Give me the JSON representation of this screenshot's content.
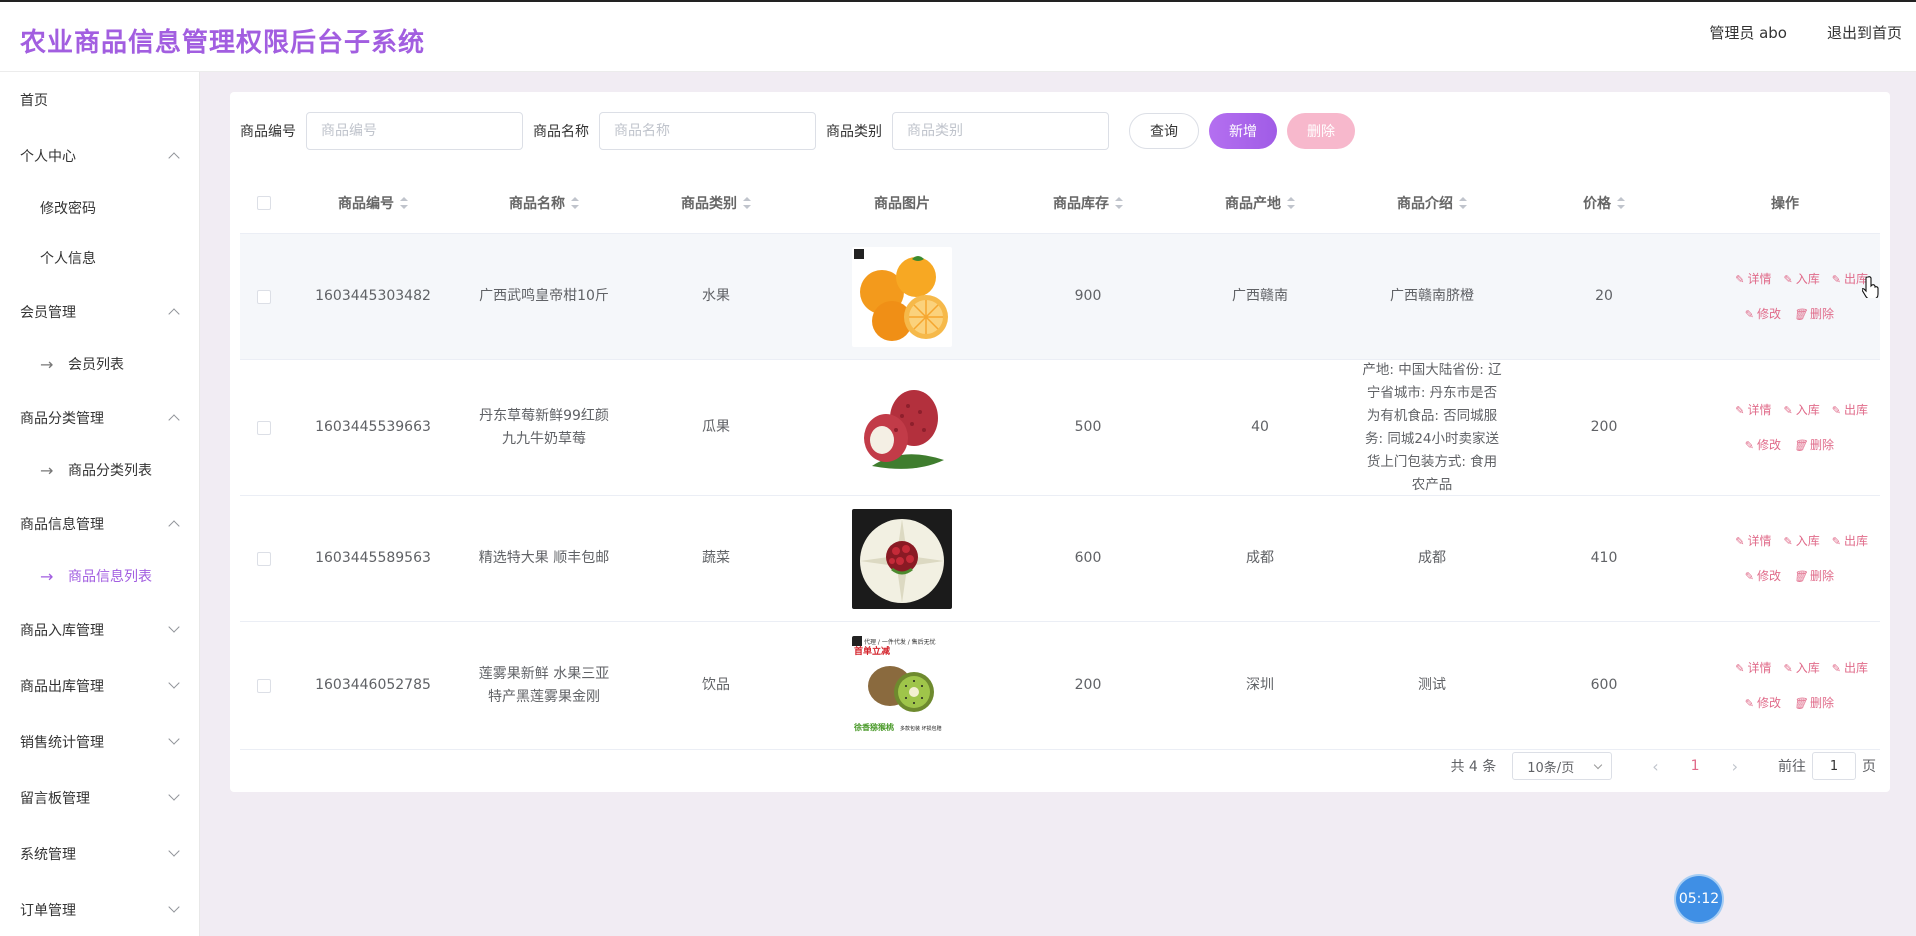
{
  "header": {
    "title": "农业商品信息管理权限后台子系统",
    "user": "管理员 abo",
    "exit": "退出到首页"
  },
  "sidebar": {
    "home": "首页",
    "personal": "个人中心",
    "change_password": "修改密码",
    "personal_info": "个人信息",
    "member_mgmt": "会员管理",
    "member_list": "会员列表",
    "category_mgmt": "商品分类管理",
    "category_list": "商品分类列表",
    "goods_mgmt": "商品信息管理",
    "goods_list": "商品信息列表",
    "inbound_mgmt": "商品入库管理",
    "outbound_mgmt": "商品出库管理",
    "sales_mgmt": "销售统计管理",
    "board_mgmt": "留言板管理",
    "system_mgmt": "系统管理",
    "order_mgmt": "订单管理"
  },
  "search": {
    "code_label": "商品编号",
    "code_placeholder": "商品编号",
    "name_label": "商品名称",
    "name_placeholder": "商品名称",
    "category_label": "商品类别",
    "category_placeholder": "商品类别",
    "query_btn": "查询",
    "add_btn": "新增",
    "delete_btn": "删除"
  },
  "table": {
    "columns": {
      "code": "商品编号",
      "name": "商品名称",
      "category": "商品类别",
      "image": "商品图片",
      "stock": "商品库存",
      "origin": "商品产地",
      "intro": "商品介绍",
      "price": "价格",
      "ops": "操作"
    },
    "rows": [
      {
        "code": "1603445303482",
        "name": "广西武鸣皇帝柑10斤",
        "category": "水果",
        "stock": "900",
        "origin": "广西赣南",
        "intro": "广西赣南脐橙",
        "price": "20"
      },
      {
        "code": "1603445539663",
        "name": "丹东草莓新鲜99红颜九九牛奶草莓",
        "category": "瓜果",
        "stock": "500",
        "origin": "40",
        "intro": "产地: 中国大陆省份: 辽宁省城市: 丹东市是否为有机食品: 否同城服务: 同城24小时卖家送货上门包装方式: 食用农产品",
        "price": "200"
      },
      {
        "code": "1603445589563",
        "name": "精选特大果 顺丰包邮",
        "category": "蔬菜",
        "stock": "600",
        "origin": "成都",
        "intro": "成都",
        "price": "410"
      },
      {
        "code": "1603446052785",
        "name": "莲雾果新鲜 水果三亚特产黑莲雾果金刚",
        "category": "饮品",
        "stock": "200",
        "origin": "深圳",
        "intro": "测试",
        "price": "600"
      }
    ],
    "ops": {
      "detail": "详情",
      "inbound": "入库",
      "outbound": "出库",
      "edit": "修改",
      "delete": "删除"
    }
  },
  "pager": {
    "total": "共 4 条",
    "page_size": "10条/页",
    "current": "1",
    "goto_label": "前往",
    "goto_value": "1",
    "page_suffix": "页"
  },
  "kiwi_banner": {
    "top": "代理 / 一件代发 / 售后无忧",
    "red": "首单立减",
    "bottom_green": "徐香猕猴桃",
    "bottom_black": "多款包装 坏损包赔"
  },
  "timer": "05:12",
  "colors": {
    "accent": "#a25ee0",
    "danger": "#e06b8a",
    "bg": "#f1ecf3"
  }
}
